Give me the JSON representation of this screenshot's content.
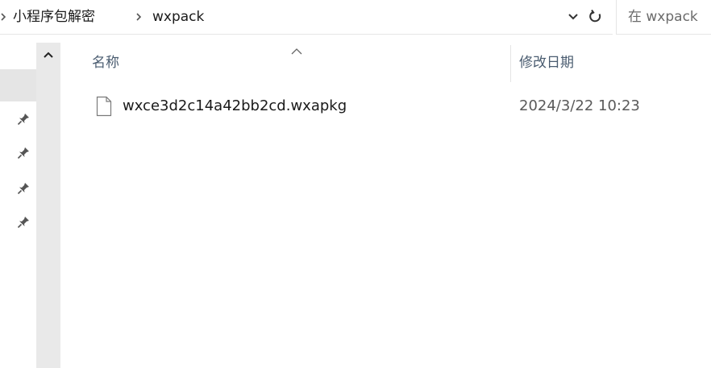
{
  "address_bar": {
    "breadcrumbs": [
      "小程序包解密",
      "wxpack"
    ],
    "separator_icon": "chevron-right-icon",
    "dropdown_icon": "chevron-down-icon",
    "refresh_icon": "refresh-icon"
  },
  "search": {
    "placeholder": "在 wxpack"
  },
  "nav_pane": {
    "pin_icon": "pin-icon",
    "pinned_count": 4,
    "scroll_up_icon": "chevron-up-icon"
  },
  "file_list": {
    "columns": {
      "name": "名称",
      "date_modified": "修改日期"
    },
    "sort_icon": "sort-ascending-caret-icon",
    "files": [
      {
        "name": "wxce3d2c14a42bb2cd.wxapkg",
        "date_modified": "2024/3/22 10:23",
        "icon": "file-icon"
      }
    ]
  },
  "colors": {
    "header_text": "#4a5c70",
    "nav_strip": "#e5e5e5",
    "scrollbar": "#e9e9e9"
  }
}
